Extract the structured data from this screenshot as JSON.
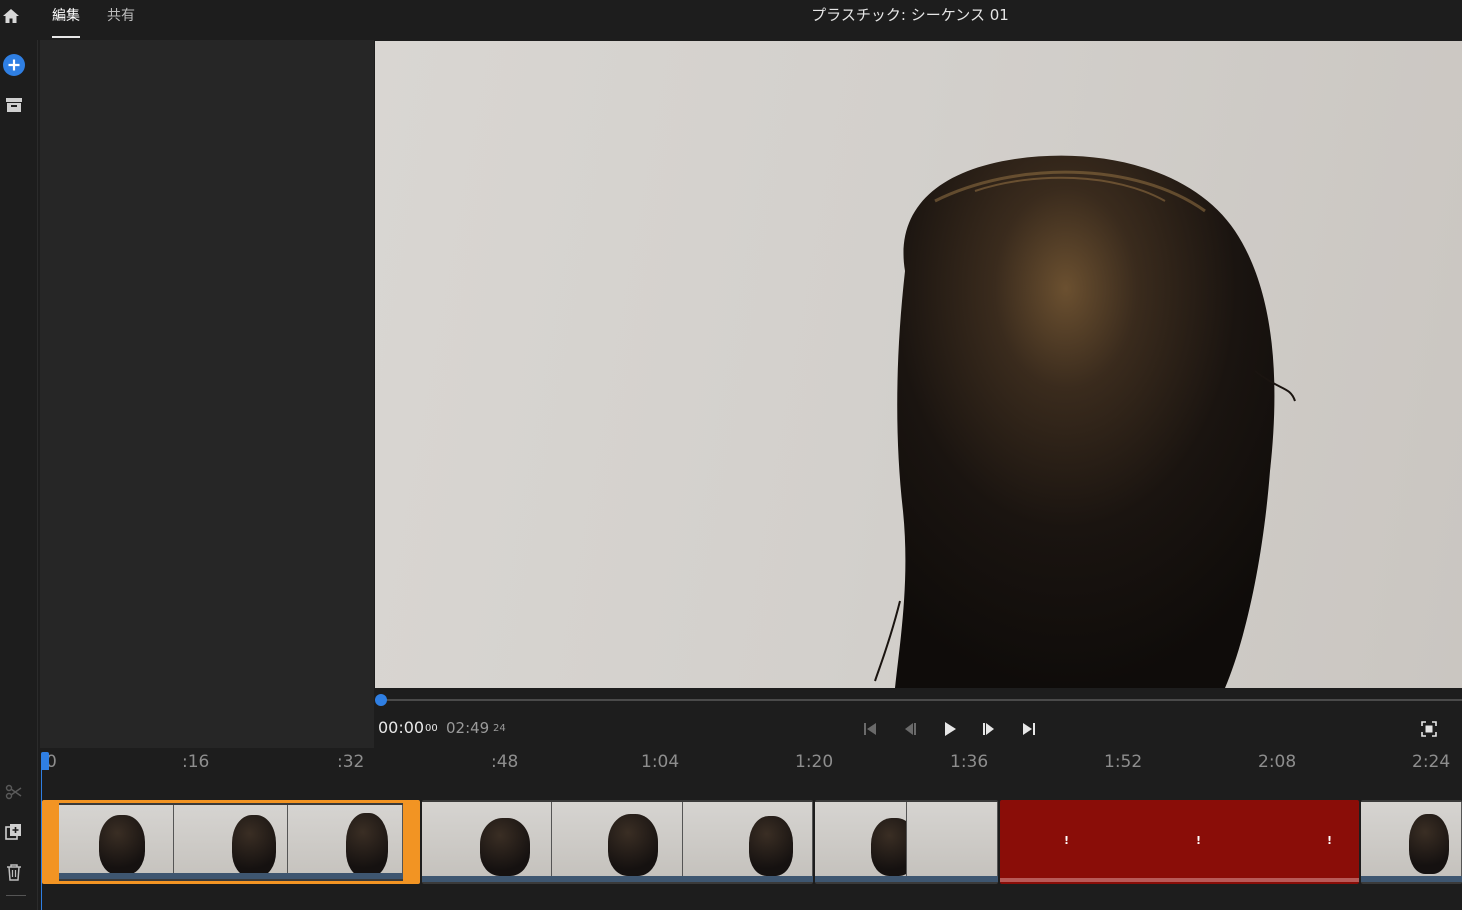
{
  "header": {
    "tabs": [
      {
        "label": "編集",
        "active": true
      },
      {
        "label": "共有",
        "active": false
      }
    ],
    "sequence_title": "プラスチック: シーケンス 01"
  },
  "icons": {
    "home": "home-icon",
    "add_media": "add-circle-icon",
    "project": "archive-icon",
    "split": "scissors-icon",
    "duplicate": "duplicate-icon",
    "delete": "trash-icon"
  },
  "player": {
    "current_time": "00:00",
    "current_frames": "00",
    "total_time": "02:49",
    "total_frames": "24",
    "progress": 0.0,
    "controls": [
      "go-to-start-icon",
      "step-back-icon",
      "play-icon",
      "step-forward-icon",
      "go-to-end-icon",
      "fit-screen-icon"
    ]
  },
  "timeline": {
    "ruler_ticks": [
      "0",
      ":16",
      ":32",
      ":48",
      "1:04",
      "1:20",
      "1:36",
      "1:52",
      "2:08",
      "2:24"
    ],
    "clips": [
      {
        "name": "clip-1",
        "selected": true,
        "offline": false,
        "thumbs": 3
      },
      {
        "name": "clip-2",
        "selected": false,
        "offline": false,
        "thumbs": 3
      },
      {
        "name": "clip-3",
        "selected": false,
        "offline": false,
        "thumbs": 2
      },
      {
        "name": "clip-4",
        "selected": false,
        "offline": true,
        "marks": [
          "!",
          "!",
          "!"
        ]
      },
      {
        "name": "clip-5",
        "selected": false,
        "offline": false,
        "thumbs": 1
      }
    ]
  },
  "colors": {
    "accent_blue": "#2f7fe3",
    "selection_orange": "#f29423",
    "offline_red": "#8a0d08",
    "background": "#1d1d1d",
    "panel": "#262626"
  }
}
